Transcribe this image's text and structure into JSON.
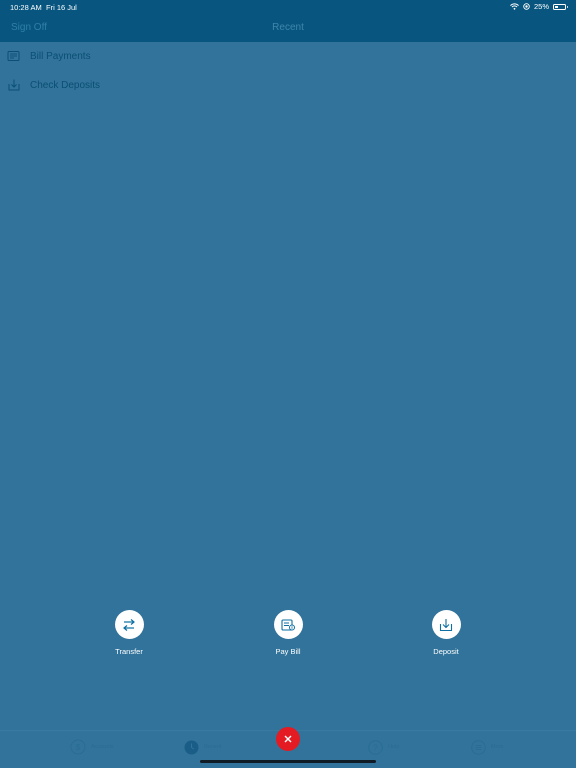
{
  "status_bar": {
    "time": "10:28 AM",
    "date": "Fri 16 Jul",
    "battery": "25%",
    "battery_level": 0.25,
    "icons": [
      "wifi-icon",
      "location-icon",
      "battery-icon"
    ]
  },
  "nav": {
    "left_label": "Sign Off",
    "title": "Recent"
  },
  "list": [
    {
      "label": "Bill Payments",
      "icon": "bill-icon"
    },
    {
      "label": "Check Deposits",
      "icon": "deposit-icon"
    }
  ],
  "actions": [
    {
      "label": "Transfer",
      "icon": "transfer-icon"
    },
    {
      "label": "Pay Bill",
      "icon": "pay-bill-icon"
    },
    {
      "label": "Deposit",
      "icon": "deposit-icon"
    }
  ],
  "tabs": [
    {
      "label": "Accounts",
      "icon": "dollar-icon"
    },
    {
      "label": "Recent",
      "icon": "clock-icon"
    },
    {
      "label": "Help",
      "icon": "question-icon"
    },
    {
      "label": "More",
      "icon": "menu-icon"
    }
  ],
  "colors": {
    "overlay": "#31739a",
    "header": "#08567f",
    "close": "#e41b23",
    "icon_blue": "#0d6fa3"
  }
}
